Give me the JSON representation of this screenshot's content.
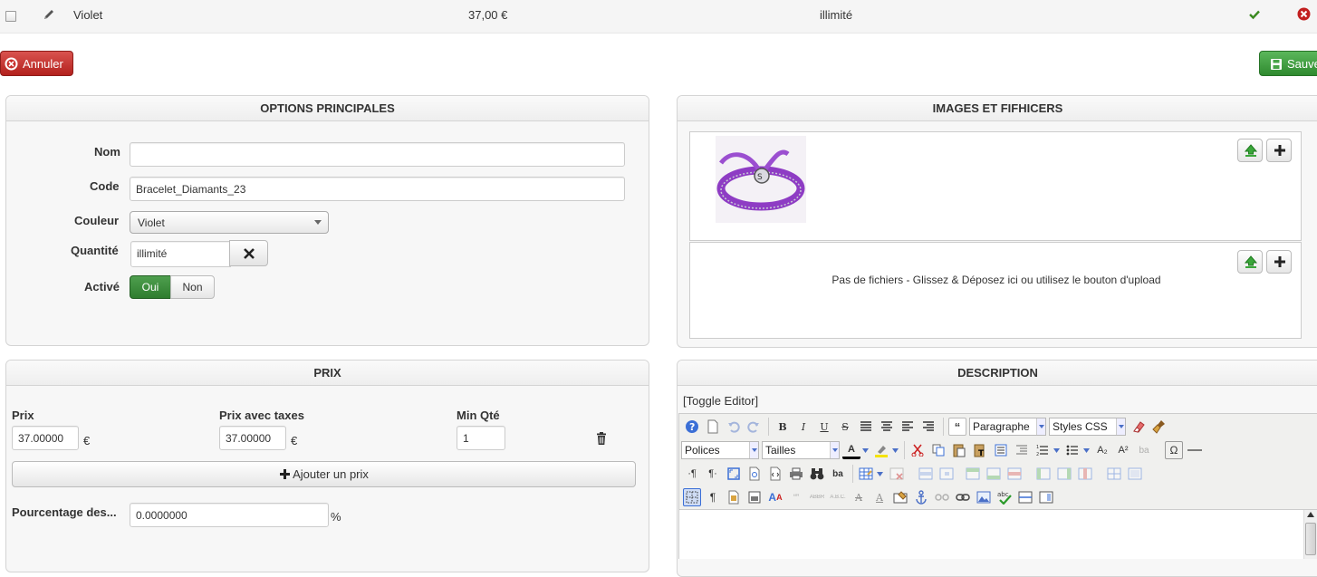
{
  "row": {
    "name": "Violet",
    "price": "37,00 €",
    "quantity": "illimité"
  },
  "actions": {
    "cancel": "Annuler",
    "save": "Sauve"
  },
  "main_options": {
    "title": "OPTIONS PRINCIPALES",
    "name_label": "Nom",
    "name_value": "",
    "code_label": "Code",
    "code_value": "Bracelet_Diamants_23",
    "color_label": "Couleur",
    "color_value": "Violet",
    "qty_label": "Quantité",
    "qty_value": "illimité",
    "active_label": "Activé",
    "yes": "Oui",
    "no": "Non"
  },
  "files": {
    "title": "IMAGES ET FIFHICERS",
    "empty_text": "Pas de fichiers - Glissez & Déposez ici ou utilisez le bouton d'upload"
  },
  "price": {
    "title": "PRIX",
    "price_label": "Prix",
    "price_value": "37.00000",
    "price_tax_label": "Prix avec taxes",
    "price_tax_value": "37.00000",
    "currency": "€",
    "min_qty_label": "Min Qté",
    "min_qty_value": "1",
    "add_price": "Ajouter un prix",
    "percent_label": "Pourcentage des...",
    "percent_value": "0.0000000",
    "percent_unit": "%"
  },
  "description": {
    "title": "DESCRIPTION",
    "toggle": "[Toggle Editor]",
    "format_select": "Paragraphe",
    "styles_select": "Styles CSS",
    "fonts_select": "Polices",
    "sizes_select": "Tailles"
  },
  "colors": {
    "cancel": "#c9302c",
    "save": "#47a447",
    "active_yes": "#3c8f3c",
    "product_purple": "#8e3cc4"
  }
}
